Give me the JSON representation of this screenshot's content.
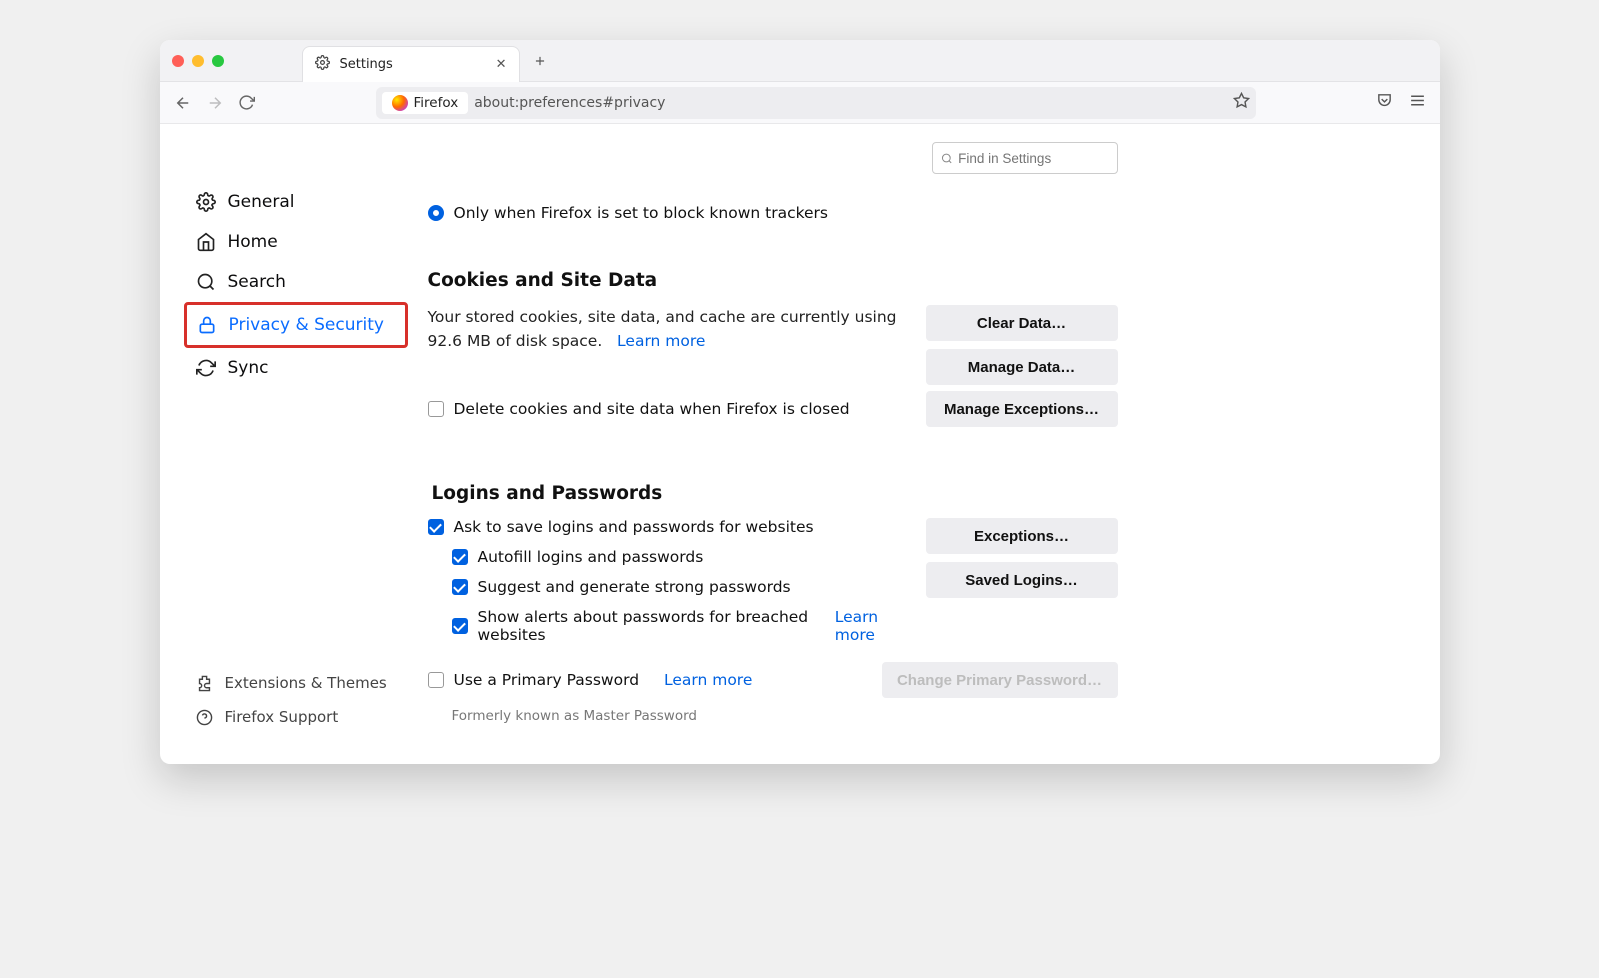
{
  "tab": {
    "title": "Settings"
  },
  "urlbar": {
    "chip": "Firefox",
    "url": "about:preferences#privacy"
  },
  "search": {
    "placeholder": "Find in Settings"
  },
  "sidebar": {
    "items": [
      {
        "label": "General"
      },
      {
        "label": "Home"
      },
      {
        "label": "Search"
      },
      {
        "label": "Privacy & Security"
      },
      {
        "label": "Sync"
      }
    ],
    "bottom": [
      {
        "label": "Extensions & Themes"
      },
      {
        "label": "Firefox Support"
      }
    ]
  },
  "tracking": {
    "radio_label": "Only when Firefox is set to block known trackers"
  },
  "cookies": {
    "heading": "Cookies and Site Data",
    "description_pre": "Your stored cookies, site data, and cache are currently using 92.6 MB of disk space.",
    "learn_more": "Learn more",
    "clear_btn": "Clear Data…",
    "manage_btn": "Manage Data…",
    "exceptions_btn": "Manage Exceptions…",
    "delete_chk": "Delete cookies and site data when Firefox is closed"
  },
  "logins": {
    "heading": "Logins and Passwords",
    "ask_save": "Ask to save logins and passwords for websites",
    "autofill": "Autofill logins and passwords",
    "suggest": "Suggest and generate strong passwords",
    "breach": "Show alerts about passwords for breached websites",
    "breach_learn": "Learn more",
    "primary": "Use a Primary Password",
    "primary_learn": "Learn more",
    "hint": "Formerly known as Master Password",
    "exceptions_btn": "Exceptions…",
    "saved_btn": "Saved Logins…",
    "change_primary_btn": "Change Primary Password…"
  }
}
